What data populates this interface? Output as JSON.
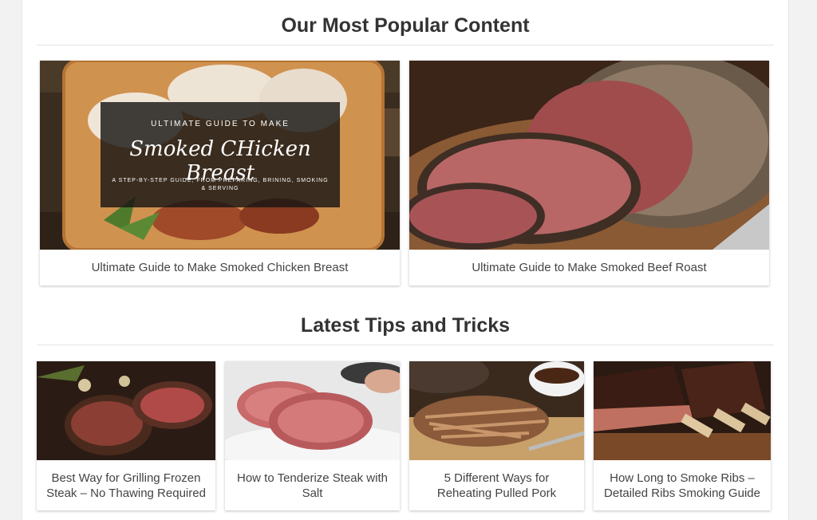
{
  "popular": {
    "title": "Our Most Popular Content",
    "cards": [
      {
        "caption": "Ultimate Guide to Make Smoked Chicken Breast",
        "image_icon": "smoked-chicken-breast-image",
        "overlay": {
          "top": "ULTIMATE GUIDE TO MAKE",
          "title": "Smoked CHicken Breast",
          "subtitle": "A STEP-BY-STEP GUIDE, FROM PREPARING, BRINING, SMOKING & SERVING"
        }
      },
      {
        "caption": "Ultimate Guide to Make Smoked Beef Roast",
        "image_icon": "smoked-beef-roast-image"
      }
    ]
  },
  "tips": {
    "title": "Latest Tips and Tricks",
    "cards": [
      {
        "caption": "Best Way for Grilling Frozen Steak – No Thawing Required",
        "image_icon": "grilled-steak-image"
      },
      {
        "caption": "How to Tenderize Steak with Salt",
        "image_icon": "raw-steak-image"
      },
      {
        "caption": "5 Different Ways for Reheating Pulled Pork",
        "image_icon": "pulled-pork-image"
      },
      {
        "caption": "How Long to Smoke Ribs – Detailed Ribs Smoking Guide",
        "image_icon": "smoked-ribs-image"
      }
    ]
  }
}
